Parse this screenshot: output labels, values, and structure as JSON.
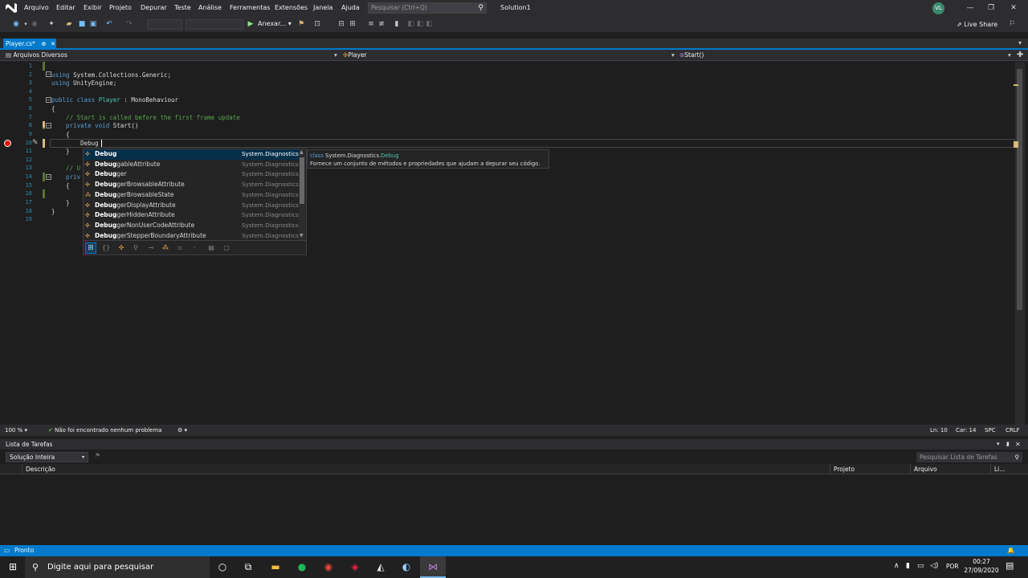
{
  "menubar": {
    "logo": "VS",
    "items": [
      "Arquivo",
      "Editar",
      "Exibir",
      "Projeto",
      "Depurar",
      "Teste",
      "Análise",
      "Ferramentas",
      "Extensões",
      "Janela",
      "Ajuda"
    ],
    "search_placeholder": "Pesquisar (Ctrl+Q)",
    "solution": "Solution1",
    "avatar": "VL"
  },
  "toolbar": {
    "attach_label": "Anexar...",
    "live_share": "Live Share"
  },
  "tab": {
    "label": "Player.cs*",
    "pin": "⊕",
    "close": "✕"
  },
  "nav": {
    "project": "Arquivos Diversos",
    "class": "Player",
    "member": "Start()"
  },
  "lines": [
    "1",
    "2",
    "3",
    "4",
    "5",
    "6",
    "7",
    "8",
    "9",
    "10",
    "11",
    "12",
    "13",
    "14",
    "15",
    "16",
    "17",
    "18",
    "19"
  ],
  "code": {
    "l2_kw": "using",
    "l2_rest": " System.Collections.Generic;",
    "l3_kw": "using",
    "l3_rest": " UnityEngine;",
    "l5_kw1": "public class ",
    "l5_ty": "Player",
    "l5_rest": " : MonoBehaviour",
    "l6": "{",
    "l7": "    // Start is called before the first frame update",
    "l8_kw": "    private void ",
    "l8_rest": "Start()",
    "l9": "    {",
    "l10": "        Debug",
    "l11": "    }",
    "l13": "    // U",
    "l14": "    priv",
    "l15": "    {",
    "l17": "    }",
    "l18": "}"
  },
  "completion": {
    "items": [
      {
        "prefix": "Debug",
        "suffix": "",
        "ns": "System.Diagnostics",
        "icon": "class-icon"
      },
      {
        "prefix": "Debug",
        "suffix": "gableAttribute",
        "ns": "System.Diagnostics",
        "icon": "class-icon"
      },
      {
        "prefix": "Debug",
        "suffix": "ger",
        "ns": "System.Diagnostics",
        "icon": "class-icon"
      },
      {
        "prefix": "Debug",
        "suffix": "gerBrowsableAttribute",
        "ns": "System.Diagnostics",
        "icon": "class-icon"
      },
      {
        "prefix": "Debug",
        "suffix": "gerBrowsableState",
        "ns": "System.Diagnostics",
        "icon": "enum-icon"
      },
      {
        "prefix": "Debug",
        "suffix": "gerDisplayAttribute",
        "ns": "System.Diagnostics",
        "icon": "class-icon"
      },
      {
        "prefix": "Debug",
        "suffix": "gerHiddenAttribute",
        "ns": "System.Diagnostics",
        "icon": "class-icon"
      },
      {
        "prefix": "Debug",
        "suffix": "gerNonUserCodeAttribute",
        "ns": "System.Diagnostics",
        "icon": "class-icon"
      },
      {
        "prefix": "Debug",
        "suffix": "gerStepperBoundaryAttribute",
        "ns": "System.Diagnostics",
        "icon": "class-icon"
      }
    ]
  },
  "tooltip": {
    "kw": "class ",
    "ns": "System.Diagnostics.",
    "ty": "Debug",
    "desc": "Fornece um conjunto de métodos e propriedades que ajudam a depurar seu código."
  },
  "editor_status": {
    "zoom": "100 %",
    "problems": "Não foi encontrado nenhum problema",
    "ln": "Ln: 10",
    "car": "Car: 14",
    "spc": "SPC",
    "crlf": "CRLF"
  },
  "tasks": {
    "title": "Lista de Tarefas",
    "filter": "Solução Inteira",
    "search": "Pesquisar Lista de Tarefas",
    "cols": [
      "Descrição",
      "Projeto",
      "Arquivo",
      "Li..."
    ]
  },
  "statusbar": {
    "text": "Pronto"
  },
  "taskbar": {
    "search": "Digite aqui para pesquisar",
    "lang": "POR",
    "time": "00:27",
    "date": "27/09/2020"
  },
  "colors": {
    "accent": "#007acc",
    "breakpoint": "#e51400"
  }
}
